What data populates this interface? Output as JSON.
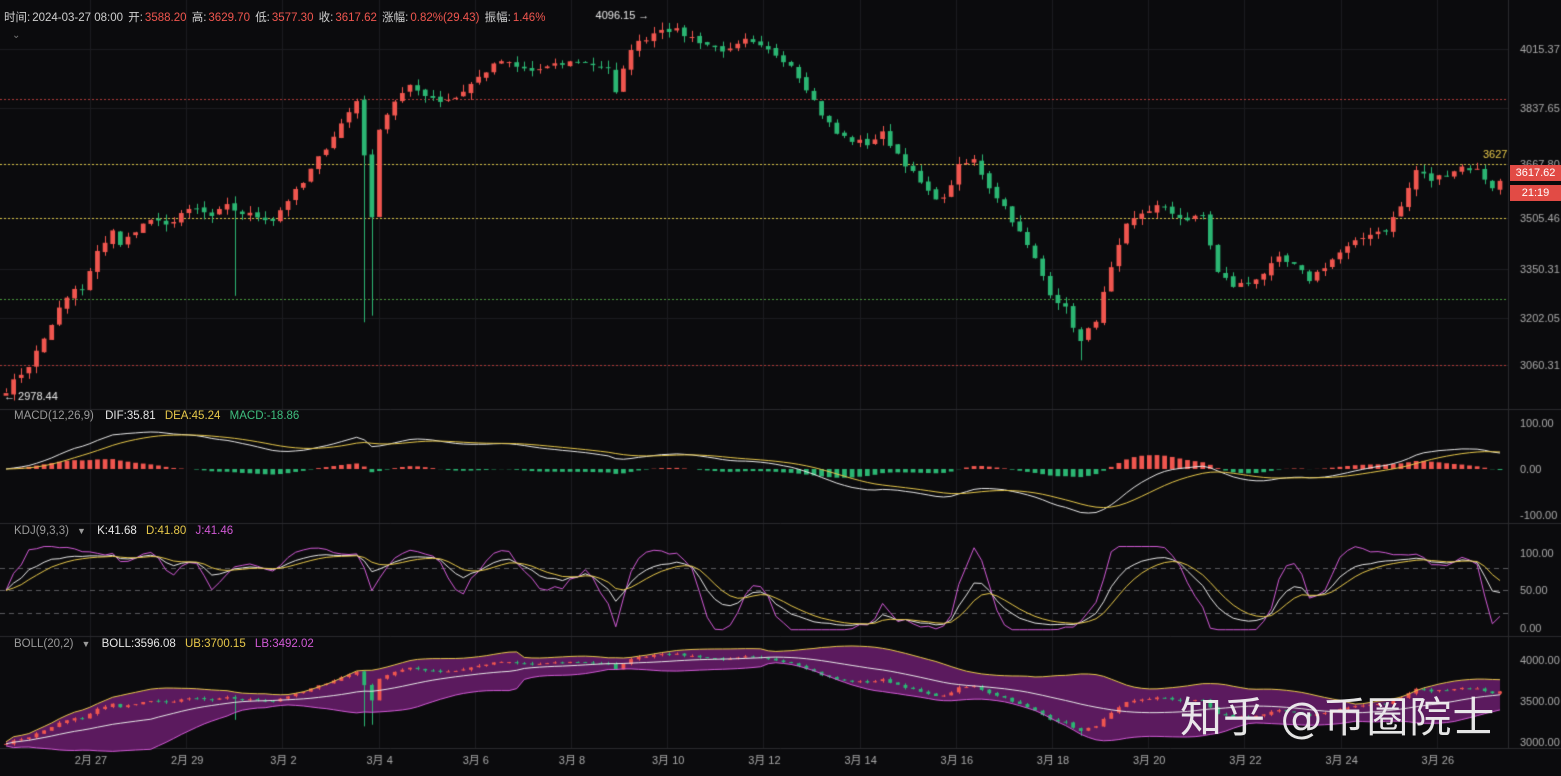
{
  "info_bar": {
    "time_label": "时间:",
    "time": "2024-03-27 08:00",
    "open_label": "开:",
    "open": "3588.20",
    "high_label": "高:",
    "high": "3629.70",
    "low_label": "低:",
    "low": "3577.30",
    "close_label": "收:",
    "close": "3617.62",
    "change_label": "涨幅:",
    "change": "0.82%(29.43)",
    "amplitude_label": "振幅:",
    "amplitude": "1.46%"
  },
  "price_tags": {
    "last_price": "3617.62",
    "countdown": "21:19"
  },
  "watermark": "知乎 @币圈院士",
  "colors": {
    "up": "#f0564f",
    "down": "#2bb673",
    "dif": "#e8e8e8",
    "dea": "#e7c84a",
    "j": "#d25ad6",
    "band_fill": "#5b1a5e"
  },
  "indicators": {
    "macd": {
      "name": "MACD(12,26,9)",
      "dif_label": "DIF:",
      "dif": "35.81",
      "dea_label": "DEA:",
      "dea": "45.24",
      "macd_label": "MACD:",
      "macd": "-18.86"
    },
    "kdj": {
      "name": "KDJ(9,3,3)",
      "k_label": "K:",
      "k": "41.68",
      "d_label": "D:",
      "d": "41.80",
      "j_label": "J:",
      "j": "41.46"
    },
    "boll": {
      "name": "BOLL(20,2)",
      "boll_label": "BOLL:",
      "boll": "3596.08",
      "ub_label": "UB:",
      "ub": "3700.15",
      "lb_label": "LB:",
      "lb": "3492.02"
    }
  },
  "chart_data": {
    "type": "candlestick",
    "price_axis": {
      "ticks": [
        4015.37,
        3837.65,
        3667.8,
        3505.46,
        3350.31,
        3202.05,
        3060.31
      ],
      "tick_labels": [
        "4015.37",
        "3837.65",
        "3667.80",
        "3505.46",
        "3350.31",
        "3202.05",
        "3060.31"
      ],
      "range": [
        2940,
        4140
      ]
    },
    "x_labels": [
      "2月 27",
      "2月 29",
      "3月 2",
      "3月 4",
      "3月 6",
      "3月 8",
      "3月 10",
      "3月 12",
      "3月 14",
      "3月 16",
      "3月 18",
      "3月 20",
      "3月 22",
      "3月 24",
      "3月 26"
    ],
    "annotations": {
      "max": 4096.15,
      "max_label": "4096.15",
      "min": 2978.44,
      "min_label": "2978.44",
      "line_label": "3627"
    },
    "horizontal_levels": [
      {
        "value": 3865,
        "style": "red"
      },
      {
        "value": 3667.8,
        "style": "yellow"
      },
      {
        "value": 3505.46,
        "style": "yellow"
      },
      {
        "value": 3260,
        "style": "green"
      },
      {
        "value": 3060.31,
        "style": "red"
      }
    ],
    "price_path": [
      [
        0,
        2985
      ],
      [
        3,
        3060
      ],
      [
        5,
        3140
      ],
      [
        7,
        3230
      ],
      [
        9,
        3290
      ],
      [
        10,
        3285
      ],
      [
        12,
        3400
      ],
      [
        14,
        3470
      ],
      [
        15,
        3420
      ],
      [
        17,
        3470
      ],
      [
        19,
        3500
      ],
      [
        21,
        3480
      ],
      [
        23,
        3520
      ],
      [
        25,
        3530
      ],
      [
        27,
        3510
      ],
      [
        29,
        3540
      ],
      [
        31,
        3520
      ],
      [
        33,
        3510
      ],
      [
        35,
        3500
      ],
      [
        37,
        3560
      ],
      [
        39,
        3610
      ],
      [
        40,
        3650
      ],
      [
        42,
        3720
      ],
      [
        44,
        3790
      ],
      [
        46,
        3860
      ],
      [
        47,
        3700
      ],
      [
        48,
        3500
      ],
      [
        49,
        3780
      ],
      [
        51,
        3860
      ],
      [
        53,
        3900
      ],
      [
        55,
        3880
      ],
      [
        57,
        3860
      ],
      [
        59,
        3870
      ],
      [
        61,
        3910
      ],
      [
        63,
        3950
      ],
      [
        65,
        3980
      ],
      [
        67,
        3960
      ],
      [
        69,
        3950
      ],
      [
        71,
        3960
      ],
      [
        73,
        3970
      ],
      [
        75,
        3980
      ],
      [
        77,
        3970
      ],
      [
        79,
        3960
      ],
      [
        80,
        3880
      ],
      [
        82,
        4020
      ],
      [
        84,
        4050
      ],
      [
        86,
        4080
      ],
      [
        88,
        4070
      ],
      [
        89,
        4060
      ],
      [
        91,
        4040
      ],
      [
        93,
        4020
      ],
      [
        95,
        4010
      ],
      [
        97,
        4040
      ],
      [
        99,
        4020
      ],
      [
        101,
        4000
      ],
      [
        103,
        3970
      ],
      [
        105,
        3900
      ],
      [
        107,
        3820
      ],
      [
        109,
        3760
      ],
      [
        111,
        3740
      ],
      [
        113,
        3730
      ],
      [
        115,
        3760
      ],
      [
        117,
        3700
      ],
      [
        119,
        3640
      ],
      [
        121,
        3580
      ],
      [
        123,
        3560
      ],
      [
        125,
        3660
      ],
      [
        127,
        3680
      ],
      [
        129,
        3600
      ],
      [
        131,
        3540
      ],
      [
        133,
        3460
      ],
      [
        135,
        3380
      ],
      [
        137,
        3280
      ],
      [
        139,
        3230
      ],
      [
        141,
        3130
      ],
      [
        143,
        3200
      ],
      [
        145,
        3350
      ],
      [
        147,
        3480
      ],
      [
        149,
        3520
      ],
      [
        151,
        3540
      ],
      [
        153,
        3520
      ],
      [
        155,
        3500
      ],
      [
        157,
        3510
      ],
      [
        159,
        3340
      ],
      [
        161,
        3300
      ],
      [
        163,
        3310
      ],
      [
        165,
        3340
      ],
      [
        167,
        3380
      ],
      [
        169,
        3360
      ],
      [
        171,
        3320
      ],
      [
        173,
        3360
      ],
      [
        175,
        3400
      ],
      [
        177,
        3430
      ],
      [
        179,
        3460
      ],
      [
        181,
        3470
      ],
      [
        183,
        3540
      ],
      [
        185,
        3650
      ],
      [
        187,
        3620
      ],
      [
        189,
        3640
      ],
      [
        191,
        3660
      ],
      [
        193,
        3650
      ],
      [
        195,
        3600
      ],
      [
        196,
        3617
      ]
    ],
    "macd_axis": {
      "tick_labels": [
        "100.00",
        "0.00",
        "-100.00"
      ],
      "range": [
        -110,
        110
      ]
    },
    "kdj_axis": {
      "tick_labels": [
        "100.00",
        "50.00",
        "0.00"
      ],
      "range": [
        -5,
        110
      ]
    },
    "boll_axis": {
      "tick_labels": [
        "4000.00",
        "3500.00",
        "3000.00"
      ],
      "range": [
        2950,
        4100
      ]
    }
  }
}
